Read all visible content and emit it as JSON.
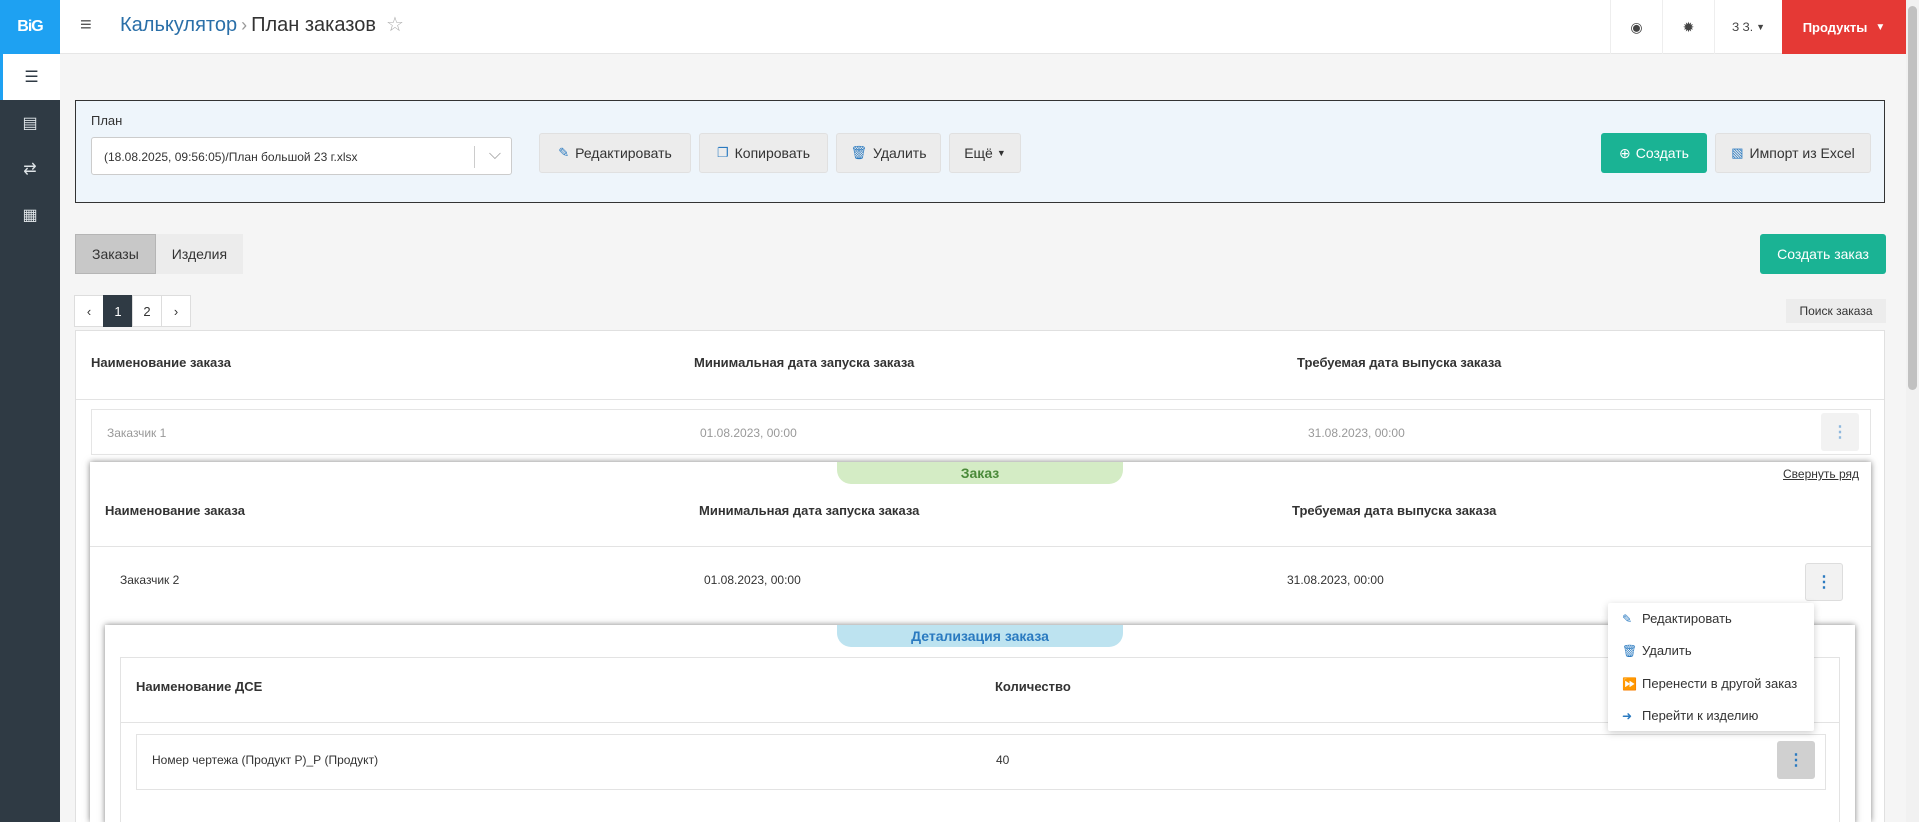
{
  "logo": "BiG",
  "sidebar": {
    "items": [
      {
        "icon": "list-icon",
        "glyph": "☰"
      },
      {
        "icon": "document-icon",
        "glyph": "▤"
      },
      {
        "icon": "exchange-icon",
        "glyph": "⇄"
      },
      {
        "icon": "calculator-icon",
        "glyph": "▦"
      }
    ]
  },
  "header": {
    "breadcrumb_root": "Калькулятор",
    "breadcrumb_sep": "›",
    "title": "План заказов",
    "star": "☆",
    "globe": "◉",
    "gear": "✹",
    "user": "З З.",
    "products": "Продукты"
  },
  "plan": {
    "label": "План",
    "selected": "(18.08.2025, 09:56:05)/План большой 23 г.xlsx",
    "edit": "Редактировать",
    "copy": "Копировать",
    "delete": "Удалить",
    "more": "Ещё",
    "create": "Создать",
    "import": "Импорт из Excel"
  },
  "tabs": {
    "orders": "Заказы",
    "products": "Изделия"
  },
  "create_order": "Создать заказ",
  "pagination": {
    "prev": "‹",
    "pages": [
      "1",
      "2"
    ],
    "next": "›",
    "active": "1"
  },
  "search_order": "Поиск заказа",
  "table": {
    "col_name": "Наименование заказа",
    "col_min_date": "Минимальная дата запуска заказа",
    "col_req_date": "Требуемая дата выпуска заказа",
    "row1": {
      "name": "Заказчик 1",
      "min_date": "01.08.2023, 00:00",
      "req_date": "31.08.2023, 00:00"
    }
  },
  "order_panel": {
    "pill": "Заказ",
    "collapse": "Свернуть ряд",
    "col_name": "Наименование заказа",
    "col_min_date": "Минимальная дата запуска заказа",
    "col_req_date": "Требуемая дата выпуска заказа",
    "row": {
      "name": "Заказчик 2",
      "min_date": "01.08.2023, 00:00",
      "req_date": "31.08.2023, 00:00"
    }
  },
  "detail_panel": {
    "pill": "Детализация заказа",
    "col_dse": "Наименование ДСЕ",
    "col_qty": "Количество",
    "row": {
      "name": "Номер чертежа (Продукт Р)_Р (Продукт)",
      "qty": "40"
    }
  },
  "menu": {
    "edit": "Редактировать",
    "delete": "Удалить",
    "move": "Перенести в другой заказ",
    "goto": "Перейти к изделию"
  },
  "colors": {
    "accent": "#1ea1f2",
    "green": "#1ab394",
    "red": "#e53935",
    "pill_order": "#d4ecc5",
    "pill_detail": "#bde3f0"
  }
}
